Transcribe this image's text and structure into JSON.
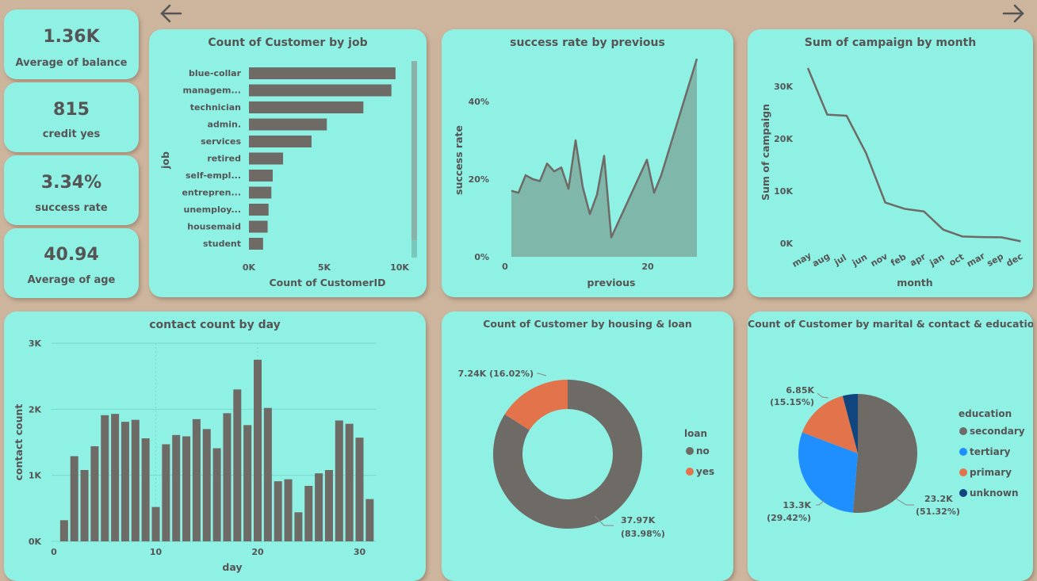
{
  "kpis": [
    {
      "value": "1.36K",
      "label": "Average of balance"
    },
    {
      "value": "815",
      "label": "credit yes"
    },
    {
      "value": "3.34%",
      "label": "success rate"
    },
    {
      "value": "40.94",
      "label": "Average of age"
    }
  ],
  "icons": {
    "back": "arrow-left-icon",
    "forward": "arrow-right-icon"
  },
  "colors": {
    "card_bg": "#8ff0e4",
    "page_bg": "#cdb49d",
    "bar": "#6e6a66",
    "area_fill": "#7fb7aa",
    "pie_no": "#6e6a66",
    "pie_yes": "#e2734b",
    "edu_secondary": "#6e6a66",
    "edu_tertiary": "#1f8fff",
    "edu_primary": "#e2734b",
    "edu_unknown": "#11457d"
  },
  "chart_data": [
    {
      "type": "bar",
      "orientation": "horizontal",
      "title": "Count of Customer by job",
      "xlabel": "Count of CustomerID",
      "ylabel": "job",
      "categories": [
        "blue-collar",
        "managem...",
        "technician",
        "admin.",
        "services",
        "retired",
        "self-empl...",
        "entrepren...",
        "unemploy...",
        "housemaid",
        "student"
      ],
      "values": [
        9730,
        9458,
        7597,
        5171,
        4154,
        2264,
        1579,
        1487,
        1303,
        1240,
        938
      ],
      "xlim": [
        0,
        10000
      ],
      "xticks": [
        "0K",
        "5K",
        "10K"
      ],
      "grid": false
    },
    {
      "type": "area",
      "title": "success rate by previous",
      "xlabel": "previous",
      "ylabel": "success rate",
      "x": [
        1,
        2,
        3,
        4,
        5,
        6,
        7,
        8,
        9,
        10,
        11,
        12,
        13,
        14,
        15,
        20,
        21,
        22,
        27
      ],
      "values": [
        17,
        16.5,
        21,
        20,
        19.5,
        24,
        22,
        23,
        17.5,
        30,
        18,
        11,
        16,
        26,
        5,
        25,
        16.5,
        21,
        51
      ],
      "ylim": [
        0,
        52
      ],
      "yticks": [
        "0%",
        "20%",
        "40%"
      ],
      "xticks": [
        "0",
        "20"
      ],
      "grid": false
    },
    {
      "type": "line",
      "title": "Sum of campaign by month",
      "xlabel": "month",
      "ylabel": "Sum of campaign",
      "categories": [
        "may",
        "aug",
        "jul",
        "jun",
        "nov",
        "feb",
        "apr",
        "jan",
        "oct",
        "mar",
        "sep",
        "dec"
      ],
      "values": [
        33500,
        24600,
        24400,
        17300,
        7800,
        6600,
        6100,
        2600,
        1300,
        1200,
        1150,
        400
      ],
      "ylim": [
        0,
        35000
      ],
      "yticks": [
        "0K",
        "10K",
        "20K",
        "30K"
      ],
      "grid": false
    },
    {
      "type": "bar",
      "title": "contact count by day",
      "xlabel": "day",
      "ylabel": "contact count",
      "categories": [
        1,
        2,
        3,
        4,
        5,
        6,
        7,
        8,
        9,
        10,
        11,
        12,
        13,
        14,
        15,
        16,
        17,
        18,
        19,
        20,
        21,
        22,
        23,
        24,
        25,
        26,
        27,
        28,
        29,
        30,
        31
      ],
      "values": [
        320,
        1290,
        1080,
        1440,
        1910,
        1930,
        1810,
        1840,
        1560,
        520,
        1470,
        1610,
        1590,
        1850,
        1700,
        1410,
        1940,
        2300,
        1760,
        2750,
        2020,
        910,
        940,
        440,
        840,
        1030,
        1080,
        1830,
        1780,
        1570,
        640
      ],
      "ylim": [
        0,
        3000
      ],
      "yticks": [
        "0K",
        "1K",
        "2K",
        "3K"
      ],
      "xticks": [
        "0",
        "10",
        "20",
        "30"
      ],
      "grid": true
    },
    {
      "type": "pie",
      "variant": "donut",
      "title": "Count of Customer by housing & loan",
      "legend_title": "loan",
      "legend_position": "right",
      "slices": [
        {
          "label": "no",
          "value": 37.97,
          "display": "37.97K",
          "pct": "(83.98%)"
        },
        {
          "label": "yes",
          "value": 7.24,
          "display": "7.24K (16.02%)",
          "pct": ""
        }
      ]
    },
    {
      "type": "pie",
      "title": "Count of Customer by marital & contact & education",
      "legend_title": "education",
      "legend_position": "right",
      "slices": [
        {
          "label": "secondary",
          "value": 51.32,
          "display": "23.2K",
          "pct": "(51.32%)"
        },
        {
          "label": "tertiary",
          "value": 29.42,
          "display": "13.3K",
          "pct": "(29.42%)"
        },
        {
          "label": "primary",
          "value": 15.15,
          "display": "6.85K",
          "pct": "(15.15%)"
        },
        {
          "label": "unknown",
          "value": 4.11,
          "display": "",
          "pct": ""
        }
      ]
    }
  ]
}
